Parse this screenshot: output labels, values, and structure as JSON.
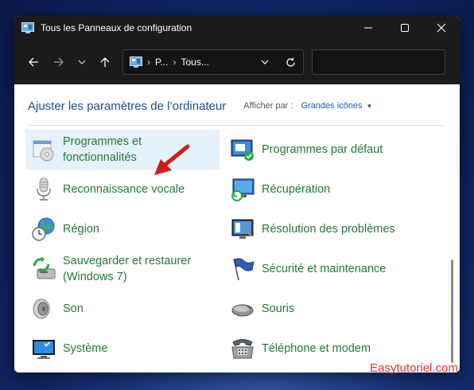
{
  "window": {
    "title": "Tous les Panneaux de configuration"
  },
  "address": {
    "crumbs": [
      "P...",
      "Tous..."
    ]
  },
  "search": {
    "placeholder": ""
  },
  "content": {
    "heading": "Ajuster les paramètres de l’ordinateur",
    "view_label": "Afficher par :",
    "view_value": "Grandes icônes"
  },
  "items": [
    {
      "label": "Programmes et\nfonctionnalités",
      "icon": "programs-icon",
      "selected": true
    },
    {
      "label": "Programmes par défaut",
      "icon": "default-programs-icon"
    },
    {
      "label": "Reconnaissance vocale",
      "icon": "microphone-icon"
    },
    {
      "label": "Récupération",
      "icon": "recovery-icon"
    },
    {
      "label": "Région",
      "icon": "globe-clock-icon"
    },
    {
      "label": "Résolution des problèmes",
      "icon": "troubleshoot-icon"
    },
    {
      "label": "Sauvegarder et restaurer\n(Windows 7)",
      "icon": "backup-icon"
    },
    {
      "label": "Sécurité et maintenance",
      "icon": "flag-icon"
    },
    {
      "label": "Son",
      "icon": "speaker-icon"
    },
    {
      "label": "Souris",
      "icon": "mouse-icon"
    },
    {
      "label": "Système",
      "icon": "system-icon"
    },
    {
      "label": "Téléphone et modem",
      "icon": "phone-icon"
    }
  ],
  "watermark": "Easytutoriel.com",
  "colors": {
    "link_green": "#217a39",
    "heading_blue": "#1e4e8c",
    "selection": "#e5f1fb",
    "arrow_red": "#d11a1a"
  }
}
